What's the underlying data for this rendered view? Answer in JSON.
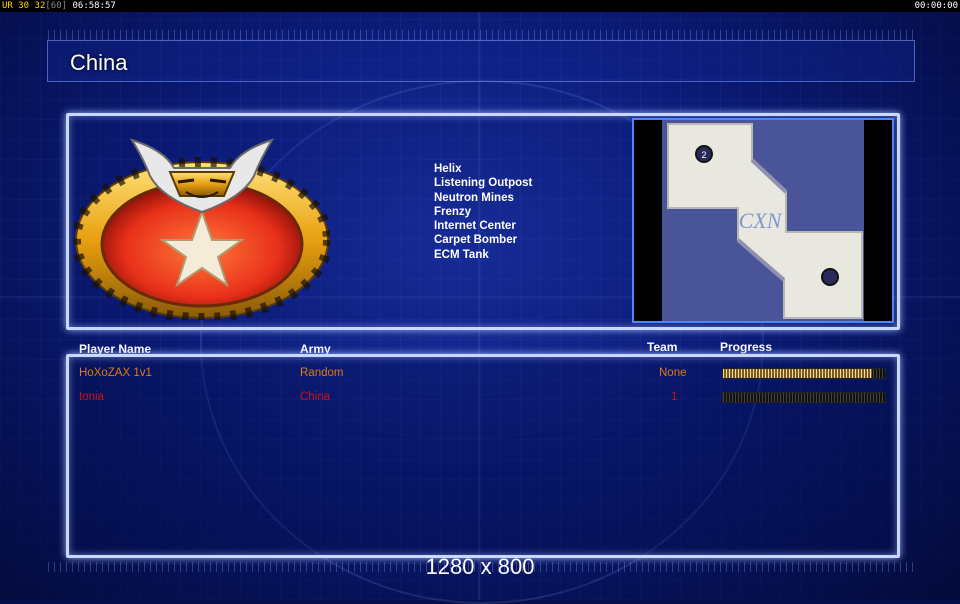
{
  "overlay": {
    "fps_label": "UR",
    "fps_value": "30",
    "fps_target": "32",
    "fps_cap": "[60]",
    "elapsed": "06:58:57",
    "clock": "00:00:00"
  },
  "faction": {
    "name": "China",
    "emblem_icon": "china-dragon-star-emblem"
  },
  "units": [
    "Helix",
    "Listening Outpost",
    "Neutron Mines",
    "Frenzy",
    "Internet Center",
    "Carpet Bomber",
    "ECM Tank"
  ],
  "map": {
    "start_marker": "2",
    "watermark": "CXN"
  },
  "table": {
    "headers": {
      "player": "Player Name",
      "army": "Army",
      "team": "Team",
      "progress": "Progress"
    },
    "players": [
      {
        "name": "HoXoZAX 1v1",
        "army": "Random",
        "team": "None",
        "progress": 0.92,
        "color": "#e07a10"
      },
      {
        "name": "tonia",
        "army": "China",
        "team": "1",
        "progress": 0.0,
        "color": "#d01010"
      }
    ]
  },
  "resolution": "1280 x 800",
  "colors": {
    "accent_blue": "#4a86ff",
    "panel_border": "#c8d8ff"
  }
}
